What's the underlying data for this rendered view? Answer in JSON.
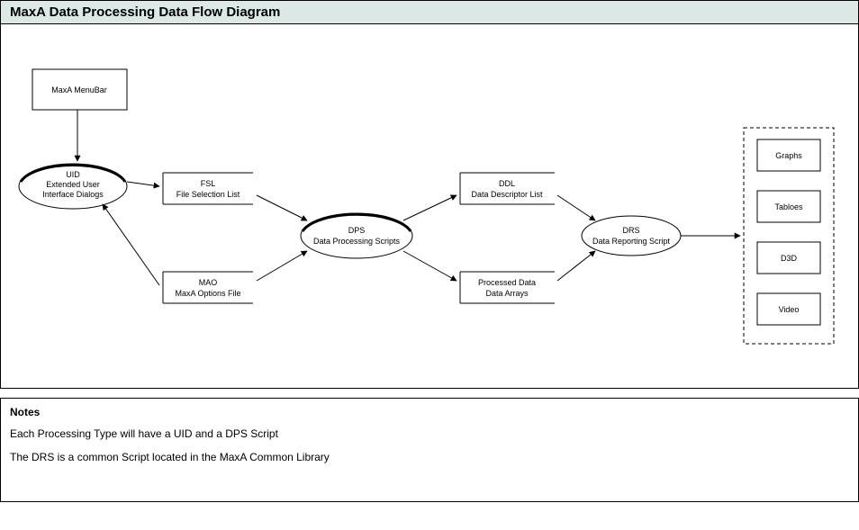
{
  "title": "MaxA Data Processing Data Flow Diagram",
  "nodes": {
    "menubar": {
      "line1": "MaxA MenuBar"
    },
    "uid": {
      "line1": "UID",
      "line2": "Extended User",
      "line3": "Interface Dialogs"
    },
    "fsl": {
      "line1": "FSL",
      "line2": "File Selection List"
    },
    "mao": {
      "line1": "MAO",
      "line2": "MaxA Options File"
    },
    "dps": {
      "line1": "DPS",
      "line2": "Data Processing Scripts"
    },
    "ddl": {
      "line1": "DDL",
      "line2": "Data Descriptor List"
    },
    "pda": {
      "line1": "Processed Data",
      "line2": "Data Arrays"
    },
    "drs": {
      "line1": "DRS",
      "line2": "Data Reporting Script"
    },
    "out1": "Graphs",
    "out2": "Tabloes",
    "out3": "D3D",
    "out4": "Video"
  },
  "notes": {
    "heading": "Notes",
    "line1": "Each Processing Type will have a UID and a DPS Script",
    "line2": "The DRS is a common Script located in the MaxA Common Library"
  }
}
